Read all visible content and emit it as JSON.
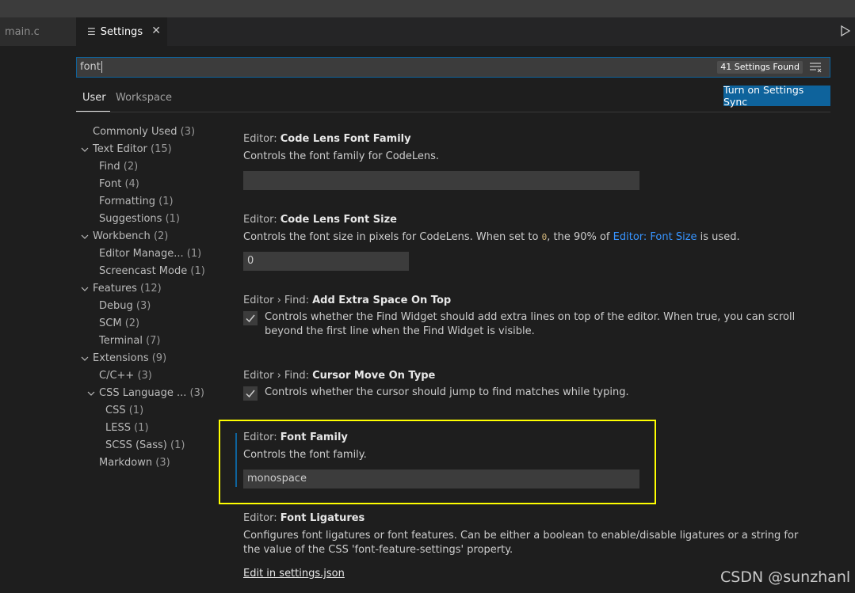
{
  "tabs": {
    "main_label": "main.c",
    "settings_icon": "☰",
    "settings_label": "Settings",
    "close_glyph": "✕"
  },
  "search": {
    "value": "font",
    "count_badge": "41 Settings Found"
  },
  "scope": {
    "user_label": "User",
    "workspace_label": "Workspace",
    "sync_button": "Turn on Settings Sync"
  },
  "toc": [
    {
      "label": "Commonly Used",
      "count": "(3)"
    },
    {
      "label": "Text Editor",
      "count": "(15)"
    },
    {
      "label": "Find",
      "count": "(2)"
    },
    {
      "label": "Font",
      "count": "(4)"
    },
    {
      "label": "Formatting",
      "count": "(1)"
    },
    {
      "label": "Suggestions",
      "count": "(1)"
    },
    {
      "label": "Workbench",
      "count": "(2)"
    },
    {
      "label": "Editor Manage...",
      "count": "(1)"
    },
    {
      "label": "Screencast Mode",
      "count": "(1)"
    },
    {
      "label": "Features",
      "count": "(12)"
    },
    {
      "label": "Debug",
      "count": "(3)"
    },
    {
      "label": "SCM",
      "count": "(2)"
    },
    {
      "label": "Terminal",
      "count": "(7)"
    },
    {
      "label": "Extensions",
      "count": "(9)"
    },
    {
      "label": "C/C++",
      "count": "(3)"
    },
    {
      "label": "CSS Language ...",
      "count": "(3)"
    },
    {
      "label": "CSS",
      "count": "(1)"
    },
    {
      "label": "LESS",
      "count": "(1)"
    },
    {
      "label": "SCSS (Sass)",
      "count": "(1)"
    },
    {
      "label": "Markdown",
      "count": "(3)"
    }
  ],
  "settings": {
    "codelens_family": {
      "category": "Editor: ",
      "name": "Code Lens Font Family",
      "desc": "Controls the font family for CodeLens.",
      "value": ""
    },
    "codelens_size": {
      "category": "Editor: ",
      "name": "Code Lens Font Size",
      "desc_a": "Controls the font size in pixels for CodeLens. When set to ",
      "desc_code": "0",
      "desc_b": ", the 90% of ",
      "desc_link": "Editor: Font Size",
      "desc_c": " is used.",
      "value": "0"
    },
    "find_extra_space": {
      "category": "Editor › Find: ",
      "name": "Add Extra Space On Top",
      "desc": "Controls whether the Find Widget should add extra lines on top of the editor. When true, you can scroll beyond the first line when the Find Widget is visible.",
      "checked": true
    },
    "find_cursor_move": {
      "category": "Editor › Find: ",
      "name": "Cursor Move On Type",
      "desc": "Controls whether the cursor should jump to find matches while typing.",
      "checked": true
    },
    "font_family": {
      "category": "Editor: ",
      "name": "Font Family",
      "desc": "Controls the font family.",
      "value": "monospace"
    },
    "font_ligatures": {
      "category": "Editor: ",
      "name": "Font Ligatures",
      "desc": "Configures font ligatures or font features. Can be either a boolean to enable/disable ligatures or a string for the value of the CSS 'font-feature-settings' property.",
      "edit_link": "Edit in settings.json"
    }
  },
  "watermark": "CSDN @sunzhanl",
  "colors": {
    "accent": "#0e639c",
    "highlight": "#ffff00",
    "link": "#3794ff"
  }
}
